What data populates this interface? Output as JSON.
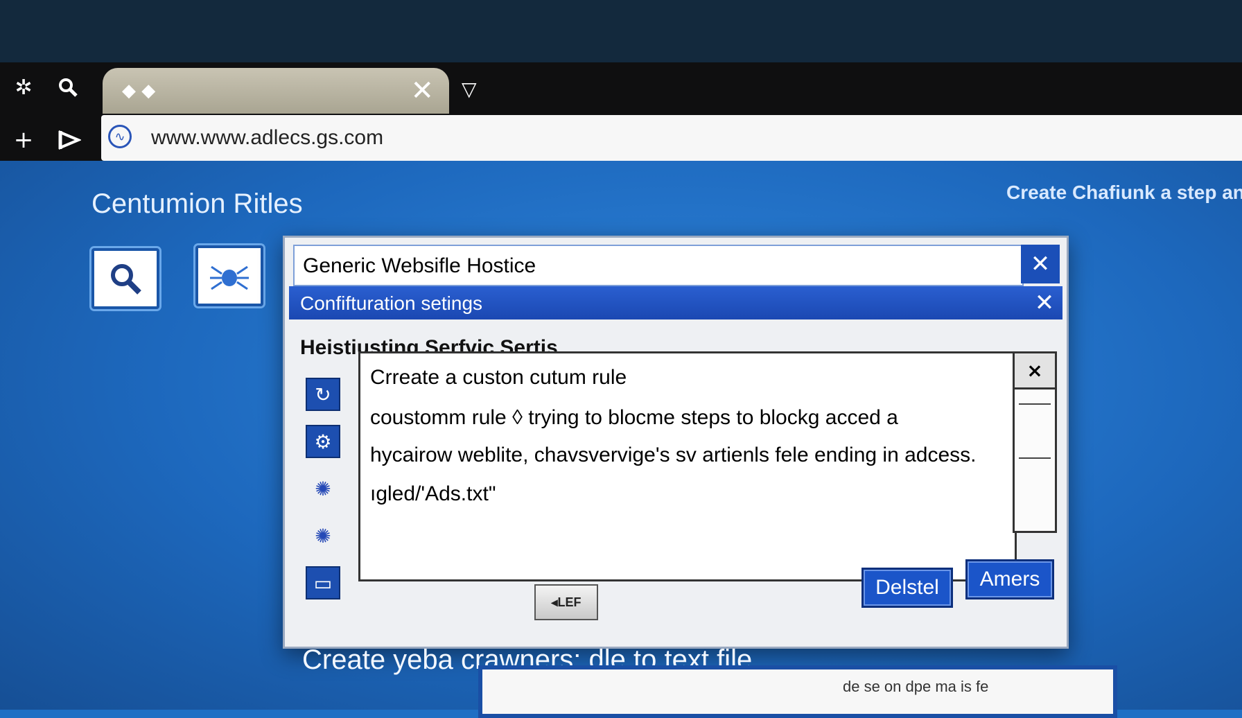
{
  "browser": {
    "tab_close_glyph": "✕",
    "dropdown_glyph": "▽",
    "url": "www.www.adlecs.gs.com"
  },
  "toolbar_icons": [
    "gear-icon",
    "search-icon",
    "plus-icon",
    "flag-icon"
  ],
  "page": {
    "title": "Centumion Ritles",
    "top_right_link": "Create Chafiunk a step and",
    "bottom_caption": "Create yeba crawners: dle to text file.",
    "bottom_panel_text": "de se on dpe ma is fe"
  },
  "side_tiles": [
    "search-icon",
    "bug-icon"
  ],
  "dialog": {
    "title": "Generic Websifle Hostice",
    "subtitle": "Confifturation setings",
    "section_title": "Heistiusting Serfvic Sertis",
    "body_lines": [
      "Crreate a custon  cutum rule",
      "coustomm rule ◊ trying to blocme steps to  blockg  acced a",
      "hycairow weblite,  chavsvervige's sv artienls fele  ending  in  adcess.",
      "ıgled/'Ads.txt\""
    ],
    "side_icons": [
      "refresh-icon",
      "gear-icon",
      "virus-icon",
      "virus-icon",
      "trash-icon"
    ],
    "scroll_close_glyph": "×",
    "small_button_label": "◂LEF",
    "delete_button_label": "Delstel",
    "confirm_button_label": "Amers"
  },
  "colors": {
    "background_blue": "#1f6fc4",
    "dialog_accent": "#1b4fb8"
  }
}
